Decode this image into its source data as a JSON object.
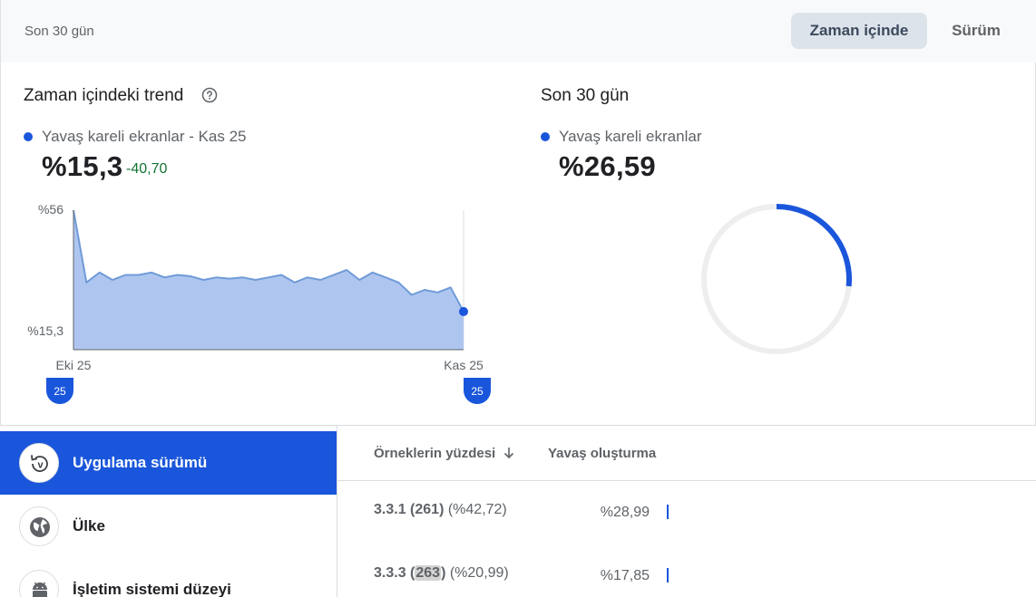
{
  "header": {
    "range_label": "Son 30 gün",
    "tabs": [
      {
        "label": "Zaman içinde",
        "active": true
      },
      {
        "label": "Sürüm",
        "active": false
      }
    ]
  },
  "trend": {
    "title": "Zaman içindeki trend",
    "legend": "Yavaş kareli ekranlar - Kas 25",
    "value": "%15,3",
    "delta": "-40,70",
    "y_top_label": "%56",
    "y_current_label": "%15,3",
    "x_start_label": "Eki 25",
    "x_end_label": "Kas 25",
    "start_marker": "25",
    "end_marker": "25"
  },
  "summary": {
    "title": "Son 30 gün",
    "legend": "Yavaş kareli ekranlar",
    "value": "%26,59",
    "fraction": 0.2659
  },
  "chart_data": {
    "type": "area",
    "series": [
      {
        "name": "Yavaş kareli ekranlar",
        "values": [
          56,
          27,
          31,
          28,
          30,
          30,
          31,
          29,
          30,
          29.5,
          28,
          29,
          28.5,
          29,
          28,
          29,
          30,
          27,
          29,
          28,
          30,
          32,
          28,
          31,
          29,
          27,
          22,
          24,
          23,
          25,
          15.3
        ]
      }
    ],
    "y_ticks": [
      "%56",
      "%15,3"
    ],
    "x_ticks": [
      "Eki 25",
      "Kas 25"
    ],
    "ylim": [
      0,
      56
    ]
  },
  "dimensions": {
    "items": [
      {
        "label": "Uygulama sürümü",
        "icon": "version-icon",
        "active": true
      },
      {
        "label": "Ülke",
        "icon": "globe-icon",
        "active": false
      },
      {
        "label": "İşletim sistemi düzeyi",
        "icon": "android-icon",
        "active": false
      }
    ]
  },
  "table": {
    "col_samples": "Örneklerin yüzdesi",
    "col_slow": "Yavaş oluşturma",
    "rows": [
      {
        "version_pre": "3.3.1 (",
        "version_code": "261",
        "version_post": ")",
        "pct": " (%42,72)",
        "slow": "%28,99",
        "highlight": false
      },
      {
        "version_pre": "3.3.3 (",
        "version_code": "263",
        "version_post": ")",
        "pct": " (%20,99)",
        "slow": "%17,85",
        "highlight": true
      }
    ]
  },
  "colors": {
    "accent": "#1a56db",
    "area_fill": "#aec6ef",
    "area_line": "#6f9ad8",
    "positive": "#137333"
  }
}
